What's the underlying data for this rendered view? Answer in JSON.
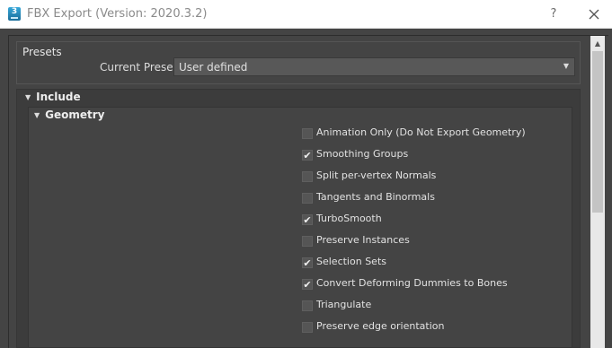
{
  "window": {
    "title": "FBX Export (Version: 2020.3.2)",
    "app_icon_text": "3",
    "help_label": "?"
  },
  "presets": {
    "title": "Presets",
    "current_label": "Current Preset:",
    "current_value": "User defined"
  },
  "include": {
    "label": "Include",
    "geometry": {
      "label": "Geometry",
      "options": [
        {
          "label": "Animation Only (Do Not Export Geometry)",
          "checked": false
        },
        {
          "label": "Smoothing Groups",
          "checked": true
        },
        {
          "label": "Split per-vertex Normals",
          "checked": false
        },
        {
          "label": "Tangents and Binormals",
          "checked": false
        },
        {
          "label": "TurboSmooth",
          "checked": true
        },
        {
          "label": "Preserve Instances",
          "checked": false
        },
        {
          "label": "Selection Sets",
          "checked": true
        },
        {
          "label": "Convert Deforming Dummies to Bones",
          "checked": true
        },
        {
          "label": "Triangulate",
          "checked": false
        },
        {
          "label": "Preserve edge orientation",
          "checked": false
        }
      ]
    }
  },
  "colors": {
    "background": "#444444",
    "panel": "#3c3c3c",
    "titlebar": "#ffffff",
    "text": "#e2e2e2"
  }
}
